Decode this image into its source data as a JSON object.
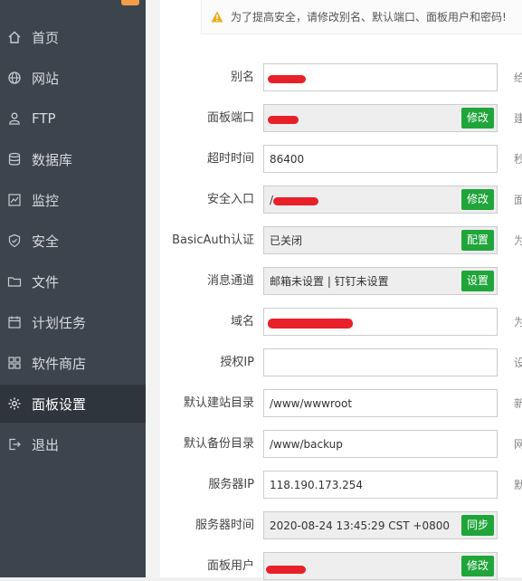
{
  "sidebar": {
    "items": [
      {
        "label": "首页",
        "icon": "home-icon"
      },
      {
        "label": "网站",
        "icon": "globe-icon"
      },
      {
        "label": "FTP",
        "icon": "ftp-user-icon"
      },
      {
        "label": "数据库",
        "icon": "database-icon"
      },
      {
        "label": "监控",
        "icon": "monitor-icon"
      },
      {
        "label": "安全",
        "icon": "shield-icon"
      },
      {
        "label": "文件",
        "icon": "folder-icon"
      },
      {
        "label": "计划任务",
        "icon": "calendar-icon"
      },
      {
        "label": "软件商店",
        "icon": "apps-grid-icon"
      },
      {
        "label": "面板设置",
        "icon": "gear-icon"
      },
      {
        "label": "退出",
        "icon": "logout-icon"
      }
    ],
    "active_index": 9
  },
  "notice": {
    "text": "为了提高安全，请修改别名、默认端口、面板用户和密码!"
  },
  "settings": [
    {
      "label": "别名",
      "value": "",
      "readonly": false,
      "button": "",
      "hint": "给"
    },
    {
      "label": "面板端口",
      "value": "",
      "readonly": true,
      "button": "修改",
      "hint": "建"
    },
    {
      "label": "超时时间",
      "value": "86400",
      "readonly": false,
      "button": "",
      "hint": "秒"
    },
    {
      "label": "安全入口",
      "value": "/",
      "readonly": true,
      "button": "修改",
      "hint": "面"
    },
    {
      "label": "BasicAuth认证",
      "value": "已关闭",
      "readonly": true,
      "button": "配置",
      "hint": "为"
    },
    {
      "label": "消息通道",
      "value": "邮箱未设置 | 钉钉未设置",
      "readonly": true,
      "button": "设置",
      "hint": ""
    },
    {
      "label": "域名",
      "value": "",
      "readonly": false,
      "button": "",
      "hint": "为"
    },
    {
      "label": "授权IP",
      "value": "",
      "readonly": false,
      "button": "",
      "hint": "设"
    },
    {
      "label": "默认建站目录",
      "value": "/www/wwwroot",
      "readonly": false,
      "button": "",
      "hint": "新"
    },
    {
      "label": "默认备份目录",
      "value": "/www/backup",
      "readonly": false,
      "button": "",
      "hint": "网"
    },
    {
      "label": "服务器IP",
      "value": "118.190.173.254",
      "readonly": false,
      "button": "",
      "hint": "默"
    },
    {
      "label": "服务器时间",
      "value": "2020-08-24 13:45:29 CST +0800",
      "readonly": true,
      "button": "同步",
      "hint": ""
    },
    {
      "label": "面板用户",
      "value": "",
      "readonly": true,
      "button": "修改",
      "hint": ""
    }
  ],
  "colors": {
    "sidebar_bg": "#3c444d",
    "active_bg": "#2f353c",
    "button_green": "#20a53a",
    "redaction": "#e8202a",
    "warning": "#f0ad1c"
  }
}
